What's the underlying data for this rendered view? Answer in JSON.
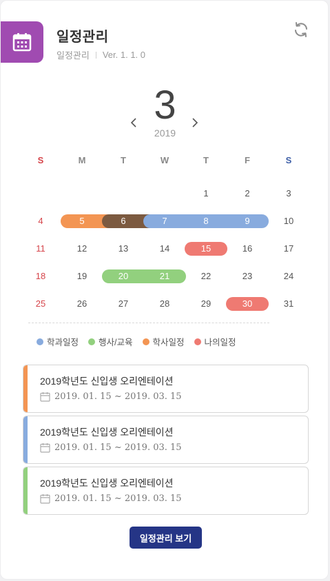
{
  "header": {
    "title": "일정관리",
    "subtitle": "일정관리",
    "version": "Ver. 1. 1. 0",
    "icon": "calendar-icon",
    "accent": "#a04bb1"
  },
  "calendar": {
    "month": "3",
    "year": "2019",
    "weekdays": [
      "S",
      "M",
      "T",
      "W",
      "T",
      "F",
      "S"
    ],
    "weeks": [
      [
        "",
        "",
        "",
        "",
        "1",
        "2",
        "3"
      ],
      [
        "4",
        "5",
        "6",
        "7",
        "8",
        "9",
        "10"
      ],
      [
        "11",
        "12",
        "13",
        "14",
        "15",
        "16",
        "17"
      ],
      [
        "18",
        "19",
        "20",
        "21",
        "22",
        "23",
        "24"
      ],
      [
        "25",
        "26",
        "27",
        "28",
        "29",
        "30",
        "31"
      ]
    ],
    "events": [
      {
        "week": 1,
        "start": 1,
        "end": 2,
        "color": "#f39553"
      },
      {
        "week": 1,
        "start": 2,
        "end": 3,
        "color": "#7c5a40"
      },
      {
        "week": 1,
        "start": 3,
        "end": 5,
        "color": "#88abde"
      },
      {
        "week": 2,
        "start": 4,
        "end": 4,
        "color": "#ef7a72"
      },
      {
        "week": 3,
        "start": 2,
        "end": 3,
        "color": "#92d07e"
      },
      {
        "week": 4,
        "start": 5,
        "end": 5,
        "color": "#ef7a72"
      }
    ]
  },
  "legend": [
    {
      "label": "학과일정",
      "color": "#88abde"
    },
    {
      "label": "행사/교육",
      "color": "#92d07e"
    },
    {
      "label": "학사일정",
      "color": "#f39553"
    },
    {
      "label": "나의일정",
      "color": "#ef7a72"
    }
  ],
  "schedule": [
    {
      "title": "2019학년도 신입생 오리엔테이션",
      "date": "2019. 01. 15 ~ 2019. 03. 15",
      "color": "#f39553"
    },
    {
      "title": "2019학년도 신입생 오리엔테이션",
      "date": "2019. 01. 15 ~ 2019. 03. 15",
      "color": "#88abde"
    },
    {
      "title": "2019학년도 신입생 오리엔테이션",
      "date": "2019. 01. 15 ~ 2019. 03. 15",
      "color": "#92d07e"
    }
  ],
  "button": {
    "label": "일정관리 보기"
  }
}
